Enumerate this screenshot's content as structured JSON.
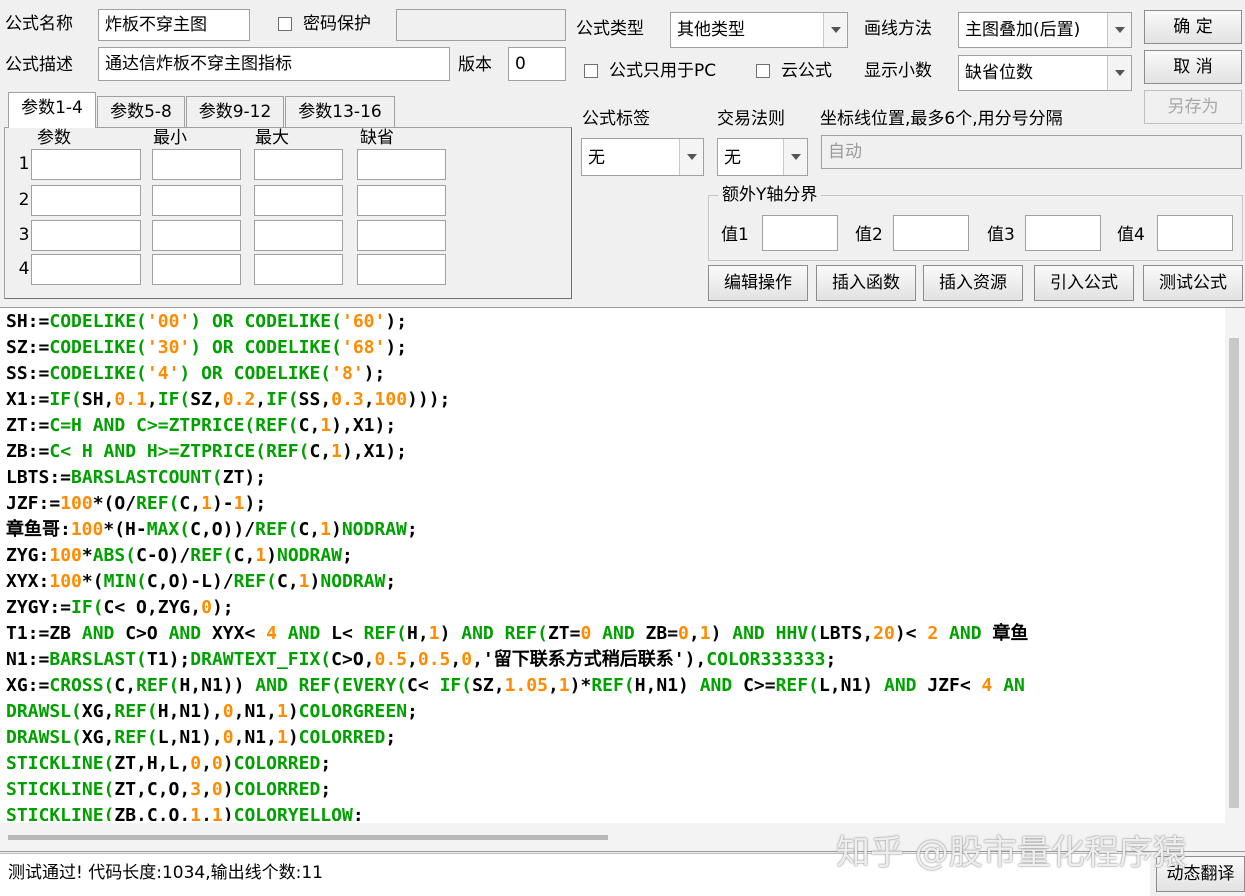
{
  "form": {
    "name_label": "公式名称",
    "name_value": "炸板不穿主图",
    "password_label": "密码保护",
    "password_value": "",
    "desc_label": "公式描述",
    "desc_value": "通达信炸板不穿主图指标",
    "version_label": "版本",
    "version_value": "0",
    "type_label": "公式类型",
    "type_value": "其他类型",
    "draw_label": "画线方法",
    "draw_value": "主图叠加(后置)",
    "pc_only_label": "公式只用于PC",
    "cloud_label": "云公式",
    "decimal_label": "显示小数",
    "decimal_value": "缺省位数"
  },
  "buttons": {
    "ok": "确  定",
    "cancel": "取  消",
    "save_as": "另存为",
    "edit_ops": "编辑操作",
    "insert_func": "插入函数",
    "insert_res": "插入资源",
    "import_formula": "引入公式",
    "test_formula": "测试公式",
    "dynamic_translate": "动态翻译"
  },
  "tabs": [
    "参数1-4",
    "参数5-8",
    "参数9-12",
    "参数13-16"
  ],
  "params": {
    "headers": [
      "参数",
      "最小",
      "最大",
      "缺省"
    ],
    "rows": [
      "1",
      "2",
      "3",
      "4"
    ]
  },
  "tag": {
    "tag_label": "公式标签",
    "tag_value": "无",
    "rule_label": "交易法则",
    "rule_value": "无",
    "coord_label": "坐标线位置,最多6个,用分号分隔",
    "coord_value": "自动"
  },
  "yaxis": {
    "title": "额外Y轴分界",
    "labels": [
      "值1",
      "值2",
      "值3",
      "值4"
    ]
  },
  "code_lines": [
    [
      [
        "SH:=",
        "black"
      ],
      [
        "CODELIKE(",
        "green"
      ],
      [
        "'00'",
        "orange"
      ],
      [
        ") OR ",
        "green"
      ],
      [
        "CODELIKE(",
        "green"
      ],
      [
        "'60'",
        "orange"
      ],
      [
        ");",
        "black"
      ]
    ],
    [
      [
        "SZ:=",
        "black"
      ],
      [
        "CODELIKE(",
        "green"
      ],
      [
        "'30'",
        "orange"
      ],
      [
        ") OR ",
        "green"
      ],
      [
        "CODELIKE(",
        "green"
      ],
      [
        "'68'",
        "orange"
      ],
      [
        ");",
        "black"
      ]
    ],
    [
      [
        "SS:=",
        "black"
      ],
      [
        "CODELIKE(",
        "green"
      ],
      [
        "'4'",
        "orange"
      ],
      [
        ") OR ",
        "green"
      ],
      [
        "CODELIKE(",
        "green"
      ],
      [
        "'8'",
        "orange"
      ],
      [
        ");",
        "black"
      ]
    ],
    [
      [
        "X1:=",
        "black"
      ],
      [
        "IF(",
        "green"
      ],
      [
        "SH,",
        "black"
      ],
      [
        "0.1",
        "orange"
      ],
      [
        ",",
        "black"
      ],
      [
        "IF(",
        "green"
      ],
      [
        "SZ,",
        "black"
      ],
      [
        "0.2",
        "orange"
      ],
      [
        ",",
        "black"
      ],
      [
        "IF(",
        "green"
      ],
      [
        "SS,",
        "black"
      ],
      [
        "0.3",
        "orange"
      ],
      [
        ",",
        "black"
      ],
      [
        "100",
        "orange"
      ],
      [
        ")));",
        "black"
      ]
    ],
    [
      [
        "ZT:=",
        "black"
      ],
      [
        "C=H AND C>=ZTPRICE(",
        "green"
      ],
      [
        "REF(",
        "green"
      ],
      [
        "C,",
        "black"
      ],
      [
        "1",
        "orange"
      ],
      [
        "),X1);",
        "black"
      ]
    ],
    [
      [
        "ZB:=",
        "black"
      ],
      [
        "C< H AND H>=ZTPRICE(",
        "green"
      ],
      [
        "REF(",
        "green"
      ],
      [
        "C,",
        "black"
      ],
      [
        "1",
        "orange"
      ],
      [
        "),X1);",
        "black"
      ]
    ],
    [
      [
        "LBTS:=",
        "black"
      ],
      [
        "BARSLASTCOUNT(",
        "green"
      ],
      [
        "ZT);",
        "black"
      ]
    ],
    [
      [
        "JZF:=",
        "black"
      ],
      [
        "100",
        "orange"
      ],
      [
        "*(O/",
        "black"
      ],
      [
        "REF(",
        "green"
      ],
      [
        "C,",
        "black"
      ],
      [
        "1",
        "orange"
      ],
      [
        ")-",
        "black"
      ],
      [
        "1",
        "orange"
      ],
      [
        ");",
        "black"
      ]
    ],
    [
      [
        "章鱼哥:",
        "black"
      ],
      [
        "100",
        "orange"
      ],
      [
        "*(H-",
        "black"
      ],
      [
        "MAX(",
        "green"
      ],
      [
        "C,O))/",
        "black"
      ],
      [
        "REF(",
        "green"
      ],
      [
        "C,",
        "black"
      ],
      [
        "1",
        "orange"
      ],
      [
        ")",
        "black"
      ],
      [
        "NODRAW",
        "green"
      ],
      [
        ";",
        "black"
      ]
    ],
    [
      [
        "ZYG:",
        "black"
      ],
      [
        "100",
        "orange"
      ],
      [
        "*",
        "black"
      ],
      [
        "ABS(",
        "green"
      ],
      [
        "C-O)/",
        "black"
      ],
      [
        "REF(",
        "green"
      ],
      [
        "C,",
        "black"
      ],
      [
        "1",
        "orange"
      ],
      [
        ")",
        "black"
      ],
      [
        "NODRAW",
        "green"
      ],
      [
        ";",
        "black"
      ]
    ],
    [
      [
        "XYX:",
        "black"
      ],
      [
        "100",
        "orange"
      ],
      [
        "*(",
        "black"
      ],
      [
        "MIN(",
        "green"
      ],
      [
        "C,O)-L)/",
        "black"
      ],
      [
        "REF(",
        "green"
      ],
      [
        "C,",
        "black"
      ],
      [
        "1",
        "orange"
      ],
      [
        ")",
        "black"
      ],
      [
        "NODRAW",
        "green"
      ],
      [
        ";",
        "black"
      ]
    ],
    [
      [
        "ZYGY:=",
        "black"
      ],
      [
        "IF(",
        "green"
      ],
      [
        "C< O,ZYG,",
        "black"
      ],
      [
        "0",
        "orange"
      ],
      [
        ");",
        "black"
      ]
    ],
    [
      [
        "T1:=ZB ",
        "black"
      ],
      [
        "AND ",
        "green"
      ],
      [
        "C>O ",
        "black"
      ],
      [
        "AND ",
        "green"
      ],
      [
        "XYX< ",
        "black"
      ],
      [
        "4",
        "orange"
      ],
      [
        " AND ",
        "green"
      ],
      [
        "L< ",
        "black"
      ],
      [
        "REF(",
        "green"
      ],
      [
        "H,",
        "black"
      ],
      [
        "1",
        "orange"
      ],
      [
        ") ",
        "black"
      ],
      [
        "AND ",
        "green"
      ],
      [
        "REF(",
        "green"
      ],
      [
        "ZT=",
        "black"
      ],
      [
        "0",
        "orange"
      ],
      [
        " AND ",
        "green"
      ],
      [
        "ZB=",
        "black"
      ],
      [
        "0",
        "orange"
      ],
      [
        ",",
        "black"
      ],
      [
        "1",
        "orange"
      ],
      [
        ") ",
        "black"
      ],
      [
        "AND ",
        "green"
      ],
      [
        "HHV(",
        "green"
      ],
      [
        "LBTS,",
        "black"
      ],
      [
        "20",
        "orange"
      ],
      [
        ")< ",
        "black"
      ],
      [
        "2",
        "orange"
      ],
      [
        " AND ",
        "green"
      ],
      [
        "章鱼",
        "black"
      ]
    ],
    [
      [
        "N1:=",
        "black"
      ],
      [
        "BARSLAST(",
        "green"
      ],
      [
        "T1);",
        "black"
      ],
      [
        "DRAWTEXT_FIX(",
        "green"
      ],
      [
        "C>O,",
        "black"
      ],
      [
        "0.5",
        "orange"
      ],
      [
        ",",
        "black"
      ],
      [
        "0.5",
        "orange"
      ],
      [
        ",",
        "black"
      ],
      [
        "0",
        "orange"
      ],
      [
        ",'留下联系方式稍后联系'),",
        "black"
      ],
      [
        "COLOR333333",
        "green"
      ],
      [
        ";",
        "black"
      ]
    ],
    [
      [
        "XG:=",
        "black"
      ],
      [
        "CROSS(",
        "green"
      ],
      [
        "C,",
        "black"
      ],
      [
        "REF(",
        "green"
      ],
      [
        "H,N1)) ",
        "black"
      ],
      [
        "AND ",
        "green"
      ],
      [
        "REF(",
        "green"
      ],
      [
        "EVERY(",
        "green"
      ],
      [
        "C< ",
        "black"
      ],
      [
        "IF(",
        "green"
      ],
      [
        "SZ,",
        "black"
      ],
      [
        "1.05",
        "orange"
      ],
      [
        ",",
        "black"
      ],
      [
        "1",
        "orange"
      ],
      [
        ")*",
        "black"
      ],
      [
        "REF(",
        "green"
      ],
      [
        "H,N1) ",
        "black"
      ],
      [
        "AND ",
        "green"
      ],
      [
        "C>=",
        "black"
      ],
      [
        "REF(",
        "green"
      ],
      [
        "L,N1) ",
        "black"
      ],
      [
        "AND ",
        "green"
      ],
      [
        "JZF< ",
        "black"
      ],
      [
        "4",
        "orange"
      ],
      [
        " AN",
        "green"
      ]
    ],
    [
      [
        "DRAWSL(",
        "green"
      ],
      [
        "XG,",
        "black"
      ],
      [
        "REF(",
        "green"
      ],
      [
        "H,N1),",
        "black"
      ],
      [
        "0",
        "orange"
      ],
      [
        ",N1,",
        "black"
      ],
      [
        "1",
        "orange"
      ],
      [
        ")",
        "black"
      ],
      [
        "COLORGREEN",
        "green"
      ],
      [
        ";",
        "black"
      ]
    ],
    [
      [
        "DRAWSL(",
        "green"
      ],
      [
        "XG,",
        "black"
      ],
      [
        "REF(",
        "green"
      ],
      [
        "L,N1),",
        "black"
      ],
      [
        "0",
        "orange"
      ],
      [
        ",N1,",
        "black"
      ],
      [
        "1",
        "orange"
      ],
      [
        ")",
        "black"
      ],
      [
        "COLORRED",
        "green"
      ],
      [
        ";",
        "black"
      ]
    ],
    [
      [
        "STICKLINE(",
        "green"
      ],
      [
        "ZT,H,L,",
        "black"
      ],
      [
        "0",
        "orange"
      ],
      [
        ",",
        "black"
      ],
      [
        "0",
        "orange"
      ],
      [
        ")",
        "black"
      ],
      [
        "COLORRED",
        "green"
      ],
      [
        ";",
        "black"
      ]
    ],
    [
      [
        "STICKLINE(",
        "green"
      ],
      [
        "ZT,C,O,",
        "black"
      ],
      [
        "3",
        "orange"
      ],
      [
        ",",
        "black"
      ],
      [
        "0",
        "orange"
      ],
      [
        ")",
        "black"
      ],
      [
        "COLORRED",
        "green"
      ],
      [
        ";",
        "black"
      ]
    ],
    [
      [
        "STICKLINE(",
        "green"
      ],
      [
        "ZB,C,O,",
        "black"
      ],
      [
        "1",
        "orange"
      ],
      [
        ",",
        "black"
      ],
      [
        "1",
        "orange"
      ],
      [
        ")",
        "black"
      ],
      [
        "COLORYELLOW",
        "green"
      ],
      [
        ";",
        "black"
      ]
    ]
  ],
  "status_text": "测试通过! 代码长度:1034,输出线个数:11",
  "watermark": "知乎 @股市量化程序猿",
  "colors": {
    "code_black": "#000000",
    "code_green": "#00a000",
    "code_orange": "#ff8c00"
  }
}
